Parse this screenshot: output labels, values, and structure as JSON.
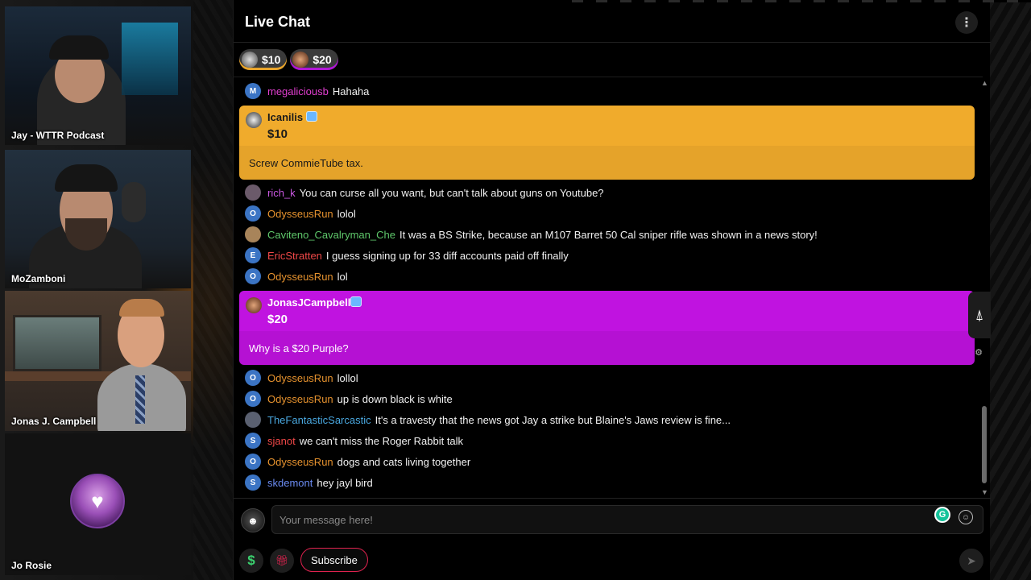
{
  "cameras": [
    {
      "name": "Jay - WTTR Podcast"
    },
    {
      "name": "MoZamboni"
    },
    {
      "name": "Jonas J. Campbell"
    },
    {
      "name": "Jo Rosie"
    }
  ],
  "chat": {
    "title": "Live Chat",
    "tickers": [
      {
        "amount": "$10",
        "color": "#e8a42b"
      },
      {
        "amount": "$20",
        "color": "#b016d6"
      }
    ],
    "messages": [
      {
        "user": "megaliciousb",
        "text": "Hahaha",
        "initial": "M",
        "avatar_color": "#3b74c4",
        "user_color": "#e23fd0"
      },
      {
        "user": "rich_k",
        "text": "You can curse all you want, but can't talk about guns on Youtube?",
        "initial": "",
        "avatar_color": "#6b5a6a",
        "user_color": "#c857e0"
      },
      {
        "user": "OdysseusRun",
        "text": "lolol",
        "initial": "O",
        "avatar_color": "#3b74c4",
        "user_color": "#e6922e"
      },
      {
        "user": "Caviteno_Cavalryman_Che",
        "text": "It was a BS Strike, because an M107 Barret 50 Cal sniper rifle was shown in a news story!",
        "initial": "",
        "avatar_color": "#a8845a",
        "user_color": "#5fc86b"
      },
      {
        "user": "EricStratten",
        "text": "I guess signing up for 33 diff accounts paid off finally",
        "initial": "E",
        "avatar_color": "#3b74c4",
        "user_color": "#f04848"
      },
      {
        "user": "OdysseusRun",
        "text": "lol",
        "initial": "O",
        "avatar_color": "#3b74c4",
        "user_color": "#e6922e"
      },
      {
        "user": "OdysseusRun",
        "text": "lollol",
        "initial": "O",
        "avatar_color": "#3b74c4",
        "user_color": "#e6922e"
      },
      {
        "user": "OdysseusRun",
        "text": "up is down black is white",
        "initial": "O",
        "avatar_color": "#3b74c4",
        "user_color": "#e6922e"
      },
      {
        "user": "TheFantasticSarcastic",
        "text": "It's a travesty that the news got Jay a strike but Blaine's Jaws review is fine...",
        "initial": "",
        "avatar_color": "#5a6070",
        "user_color": "#4aa8e0"
      },
      {
        "user": "sjanot",
        "text": "we can't miss the Roger Rabbit talk",
        "initial": "S",
        "avatar_color": "#3b74c4",
        "user_color": "#f04848"
      },
      {
        "user": "OdysseusRun",
        "text": "dogs and cats living together",
        "initial": "O",
        "avatar_color": "#3b74c4",
        "user_color": "#e6922e"
      },
      {
        "user": "skdemont",
        "text": "hey jayl bird",
        "initial": "S",
        "avatar_color": "#3b74c4",
        "user_color": "#6a8af0"
      }
    ],
    "superchats": [
      {
        "user": "Icanilis",
        "amount": "$10",
        "text": "Screw CommieTube tax.",
        "color": "#f0ab2c"
      },
      {
        "user": "JonasJCampbell",
        "amount": "$20",
        "text": "Why is a $20 Purple?",
        "color": "#c013e0"
      }
    ],
    "composer": {
      "placeholder": "Your message here!",
      "subscribe_label": "Subscribe"
    }
  }
}
